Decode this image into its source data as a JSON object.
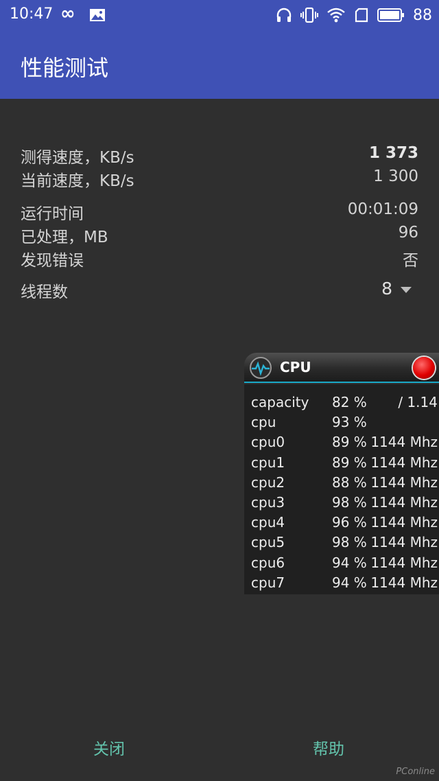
{
  "status_bar": {
    "time": "10:47",
    "battery": "88",
    "icons": [
      "infinity-icon",
      "image-icon",
      "headphones-icon",
      "vibrate-icon",
      "wifi-icon",
      "sim-card-icon",
      "battery-icon"
    ]
  },
  "app_bar": {
    "title": "性能测试"
  },
  "metrics": {
    "measured_speed_label": "测得速度，KB/s",
    "measured_speed_value": "1 373",
    "current_speed_label": "当前速度，KB/s",
    "current_speed_value": "1 300",
    "run_time_label": "运行时间",
    "run_time_value": "00:01:09",
    "processed_label": "已处理，MB",
    "processed_value": "96",
    "errors_label": "发现错误",
    "errors_value": "否",
    "threads_label": "线程数",
    "threads_value": "8"
  },
  "cpu_overlay": {
    "title": "CPU",
    "rows": [
      {
        "name": "capacity",
        "pct": "82 %",
        "freq": "/ 1.14"
      },
      {
        "name": "cpu",
        "pct": "93 %",
        "freq": ""
      },
      {
        "name": "cpu0",
        "pct": "89 %",
        "freq": "1144 Mhz"
      },
      {
        "name": "cpu1",
        "pct": "89 %",
        "freq": "1144 Mhz"
      },
      {
        "name": "cpu2",
        "pct": "88 %",
        "freq": "1144 Mhz"
      },
      {
        "name": "cpu3",
        "pct": "98 %",
        "freq": "1144 Mhz"
      },
      {
        "name": "cpu4",
        "pct": "96 %",
        "freq": "1144 Mhz"
      },
      {
        "name": "cpu5",
        "pct": "98 %",
        "freq": "1144 Mhz"
      },
      {
        "name": "cpu6",
        "pct": "94 %",
        "freq": "1144 Mhz"
      },
      {
        "name": "cpu7",
        "pct": "94 %",
        "freq": "1144 Mhz"
      }
    ]
  },
  "buttons": {
    "close": "关闭",
    "help": "帮助"
  },
  "watermark": "PConline",
  "colors": {
    "app_bar": "#3f51b5",
    "background": "#2f2f2f",
    "button_text": "#63c3ac",
    "accent_line": "#19a9c8",
    "record": "#e00000"
  }
}
